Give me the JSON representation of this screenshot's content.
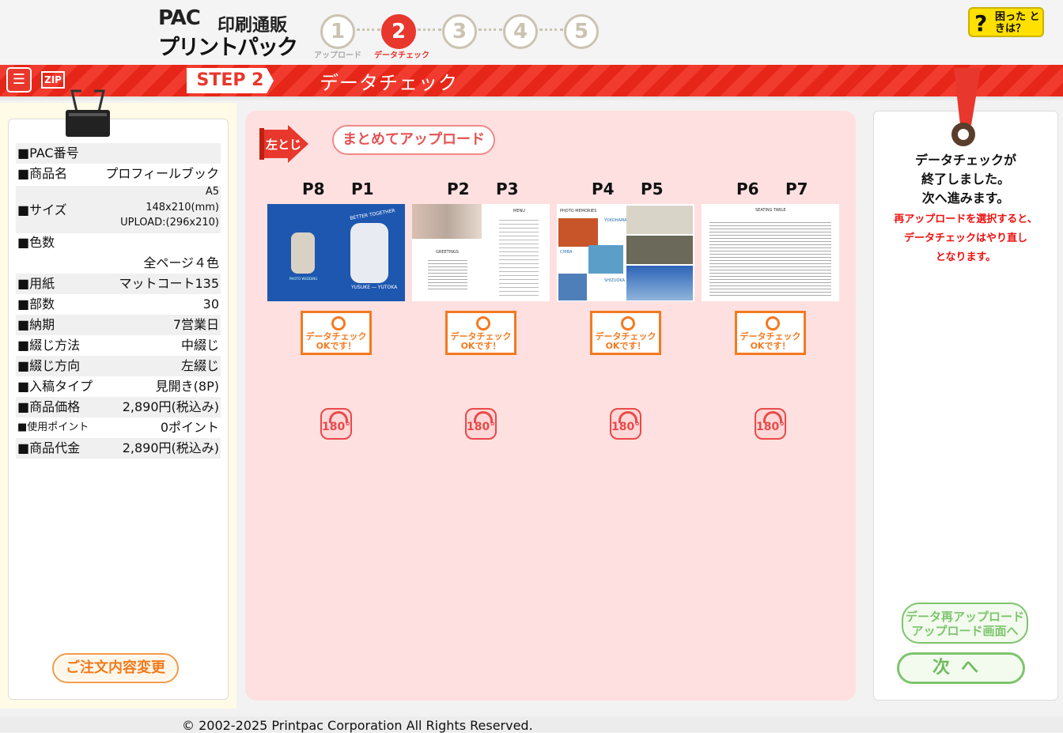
{
  "header": {
    "logo_pac": "PAC",
    "logo_title": "印刷通販",
    "logo_sub": "プリントパック",
    "steps": [
      {
        "num": "1",
        "label": "アップロード"
      },
      {
        "num": "2",
        "label": "データチェック"
      },
      {
        "num": "3",
        "label": ""
      },
      {
        "num": "4",
        "label": ""
      },
      {
        "num": "5",
        "label": ""
      }
    ],
    "help_label": "困った ときは？",
    "help_q": "?"
  },
  "stepbar": {
    "clip_icon": "clipboard-icon",
    "zip_label": "ZIP",
    "step_tag": "STEP 2",
    "title": "データチェック"
  },
  "order_info": {
    "rows": [
      {
        "key": "■PAC番号",
        "value": ""
      },
      {
        "key": "■商品名",
        "value": "プロフィールブック"
      },
      {
        "key": "■サイズ",
        "value_lines": [
          "A5",
          "148x210(mm)",
          "UPLOAD:(296x210)"
        ]
      },
      {
        "key": "■色数",
        "value": ""
      },
      {
        "key": "",
        "value": "全ページ４色"
      },
      {
        "key": "■用紙",
        "value": "マットコート135"
      },
      {
        "key": "■部数",
        "value": "30"
      },
      {
        "key": "■納期",
        "value": "7営業日"
      },
      {
        "key": "■綴じ方法",
        "value": "中綴じ"
      },
      {
        "key": "■綴じ方向",
        "value": "左綴じ"
      },
      {
        "key": "■入稿タイプ",
        "value": "見開き(8P)"
      },
      {
        "key": "■商品価格",
        "value": "2,890円(税込み)"
      },
      {
        "key": "■使用ポイント",
        "value": "0ポイント"
      },
      {
        "key": "■商品代金",
        "value": "2,890円(税込み)"
      }
    ],
    "change_button": "ご注文内容変更"
  },
  "check_area": {
    "binding_label": "左とじ",
    "bulk_upload": "まとめてアップロード",
    "spreads": [
      {
        "left": "P8",
        "right": "P1",
        "ok_line1": "データチェック",
        "ok_line2": "OKです！",
        "rotate": "180°"
      },
      {
        "left": "P2",
        "right": "P3",
        "ok_line1": "データチェック",
        "ok_line2": "OKです！",
        "rotate": "180°"
      },
      {
        "left": "P4",
        "right": "P5",
        "ok_line1": "データチェック",
        "ok_line2": "OKです！",
        "rotate": "180°"
      },
      {
        "left": "P6",
        "right": "P7",
        "ok_line1": "データチェック",
        "ok_line2": "OKです！",
        "rotate": "180°"
      }
    ],
    "thumb_text": {
      "t1_title": "BETTER TOGETHER",
      "t1_names": "YUSUKE ― YUTOKA",
      "t1_sub": "PHOTO WEDDING",
      "t2_title": "MENU",
      "t2_greet": "GREETINGS",
      "t3_title": "PHOTO MEMORIES",
      "t3_a": "YOKOHAMA",
      "t3_b": "CHIBA",
      "t3_c": "SHIZUOKA",
      "t4_title": "SEATING TABLE"
    }
  },
  "right_panel": {
    "message_lines": [
      "データチェックが",
      "終了しました。",
      "次へ進みます。"
    ],
    "warning_lines": [
      "再アップロードを選択すると、",
      "データチェックはやり直し",
      "となります。"
    ],
    "reupload_line1": "データ再アップロード",
    "reupload_line2": "アップロード画面へ",
    "next_label": "次へ"
  },
  "footer": {
    "copyright": "© 2002-2025 Printpac Corporation All Rights Reserved."
  },
  "colors": {
    "brand_red": "#e8372c",
    "ok_orange": "#f47a20",
    "next_green": "#7ec46d",
    "center_bg": "#ffe0e0"
  }
}
